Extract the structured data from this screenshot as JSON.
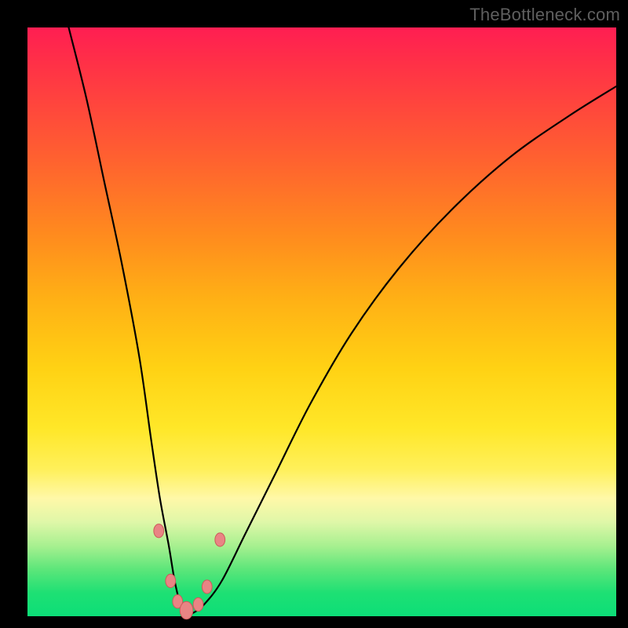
{
  "watermark": "TheBottleneck.com",
  "colors": {
    "background": "#000000",
    "curve": "#000000",
    "marker_fill": "#e98484",
    "marker_stroke": "#cc5b5b"
  },
  "chart_data": {
    "type": "line",
    "title": "",
    "xlabel": "",
    "ylabel": "",
    "xlim": [
      0,
      100
    ],
    "ylim": [
      0,
      100
    ],
    "legend": false,
    "grid": false,
    "series": [
      {
        "name": "bottleneck-curve",
        "x": [
          7,
          10,
          13,
          16,
          19,
          21,
          22.5,
          24,
          25,
          26,
          27,
          28,
          30,
          33,
          37,
          42,
          48,
          55,
          63,
          72,
          82,
          92,
          100
        ],
        "y": [
          100,
          88,
          74,
          60,
          44,
          30,
          20,
          12,
          6,
          2,
          0.5,
          0.5,
          2,
          6,
          14,
          24,
          36,
          48,
          59,
          69,
          78,
          85,
          90
        ]
      }
    ],
    "markers": [
      {
        "x": 22.3,
        "y": 14.5,
        "r": 1.0
      },
      {
        "x": 24.3,
        "y": 6.0,
        "r": 1.0
      },
      {
        "x": 25.5,
        "y": 2.5,
        "r": 1.0
      },
      {
        "x": 27.0,
        "y": 1.0,
        "r": 1.3
      },
      {
        "x": 29.0,
        "y": 2.0,
        "r": 1.0
      },
      {
        "x": 30.5,
        "y": 5.0,
        "r": 1.0
      },
      {
        "x": 32.7,
        "y": 13.0,
        "r": 1.0
      }
    ]
  }
}
